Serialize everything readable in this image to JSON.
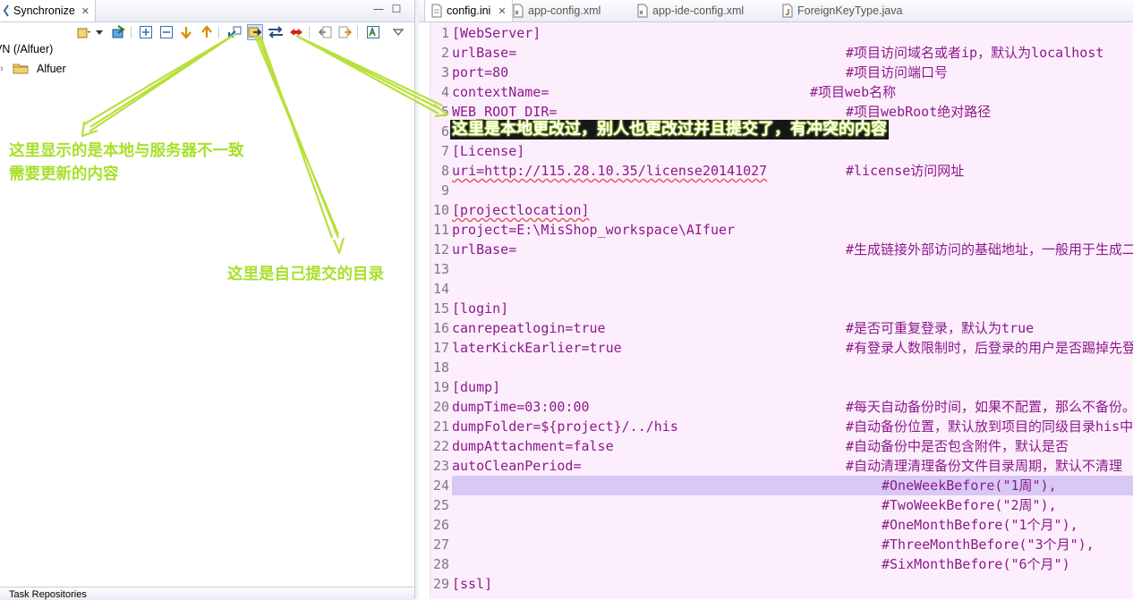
{
  "left_panel": {
    "tab_label": "Synchronize",
    "tree_root": "VN (/Alfuer)",
    "tree_child": "Alfuer",
    "bottom_tab_label": "Task Repositories"
  },
  "editor": {
    "tabs": [
      {
        "label": "config.ini",
        "active": true
      },
      {
        "label": "app-config.xml",
        "active": false
      },
      {
        "label": "app-ide-config.xml",
        "active": false
      },
      {
        "label": "ForeignKeyType.java",
        "active": false
      }
    ],
    "lines": [
      {
        "n": "1",
        "code": "[WebServer]",
        "comment": ""
      },
      {
        "n": "2",
        "code": "urlBase=",
        "comment": "#项目访问域名或者ip，默认为localhost"
      },
      {
        "n": "3",
        "code": "port=80",
        "comment": "#项目访问端口号"
      },
      {
        "n": "4",
        "code": "contextName=",
        "comment": "#项目web名称"
      },
      {
        "n": "5",
        "code": "WEB_ROOT_DIR=",
        "comment": "#项目webRoot绝对路径"
      },
      {
        "n": "6",
        "code": "",
        "comment": ""
      },
      {
        "n": "7",
        "code": "[License]",
        "comment": ""
      },
      {
        "n": "8",
        "code": "uri=http://115.28.10.35/license20141027",
        "comment": "#license访问网址"
      },
      {
        "n": "9",
        "code": "",
        "comment": ""
      },
      {
        "n": "10",
        "code": "[projectlocation]",
        "comment": ""
      },
      {
        "n": "11",
        "code": "project=E:\\MisShop_workspace\\AIfuer",
        "comment": ""
      },
      {
        "n": "12",
        "code": "urlBase=",
        "comment": "#生成链接外部访问的基础地址，一般用于生成二"
      },
      {
        "n": "13",
        "code": "",
        "comment": ""
      },
      {
        "n": "14",
        "code": "",
        "comment": ""
      },
      {
        "n": "15",
        "code": "[login]",
        "comment": ""
      },
      {
        "n": "16",
        "code": "canrepeatlogin=true",
        "comment": "#是否可重复登录，默认为true"
      },
      {
        "n": "17",
        "code": "laterKickEarlier=true",
        "comment": "#有登录人数限制时，后登录的用户是否踢掉先登"
      },
      {
        "n": "18",
        "code": "",
        "comment": ""
      },
      {
        "n": "19",
        "code": "[dump]",
        "comment": ""
      },
      {
        "n": "20",
        "code": "dumpTime=03:00:00",
        "comment": "#每天自动备份时间，如果不配置，那么不备份。"
      },
      {
        "n": "21",
        "code": "dumpFolder=${project}/../his",
        "comment": "#自动备份位置，默认放到项目的同级目录his中"
      },
      {
        "n": "22",
        "code": "dumpAttachment=false",
        "comment": "#自动备份中是否包含附件，默认是否"
      },
      {
        "n": "23",
        "code": "autoCleanPeriod=",
        "comment": "#自动清理清理备份文件目录周期，默认不清理"
      },
      {
        "n": "24",
        "code": "",
        "comment": "#OneWeekBefore(\"1周\"),"
      },
      {
        "n": "25",
        "code": "",
        "comment": "#TwoWeekBefore(\"2周\"),"
      },
      {
        "n": "26",
        "code": "",
        "comment": "#OneMonthBefore(\"1个月\"),"
      },
      {
        "n": "27",
        "code": "",
        "comment": "#ThreeMonthBefore(\"3个月\"),"
      },
      {
        "n": "28",
        "code": "",
        "comment": "#SixMonthBefore(\"6个月\")"
      },
      {
        "n": "29",
        "code": "[ssl]",
        "comment": ""
      }
    ]
  },
  "annotations": {
    "conflict": "这里是本地更改过，别人也更改过并且提交了，有冲突的内容",
    "incoming_line1": "这里显示的是本地与服务器不一致",
    "incoming_line2": "需要更新的内容",
    "outgoing": "这里是自己提交的目录"
  },
  "colors": {
    "annotation_text": "#a6e02a",
    "arrow": "#b8e03a",
    "editor_bg": "#fdeefd",
    "code_text": "#8b1a8b",
    "highlight_line": "#d8c8f5"
  }
}
